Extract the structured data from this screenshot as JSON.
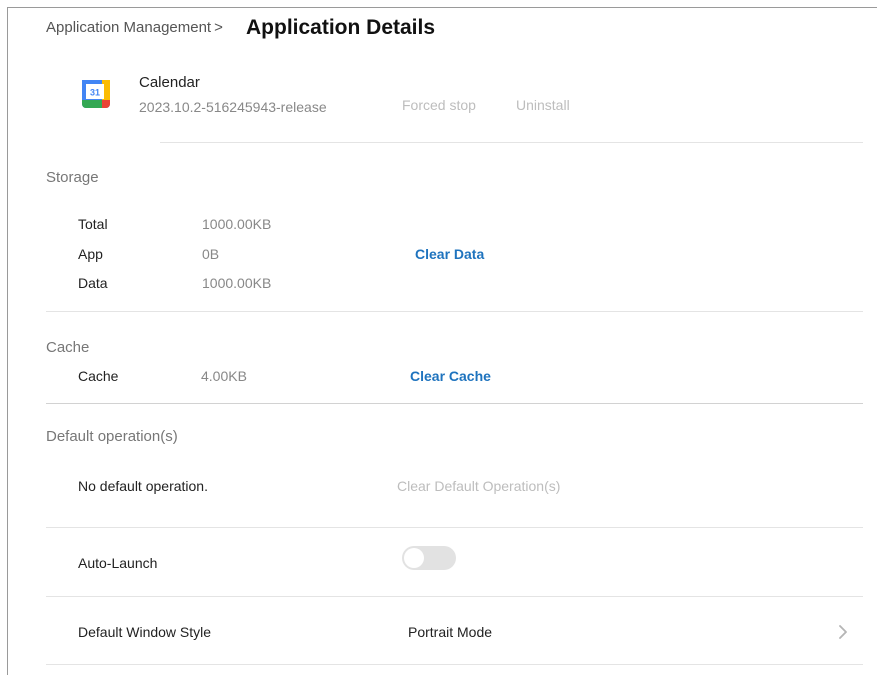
{
  "breadcrumb": {
    "parent": "Application Management",
    "separator": ">"
  },
  "page": {
    "title": "Application Details"
  },
  "app": {
    "name": "Calendar",
    "version": "2023.10.2-516245943-release",
    "icon": "google-calendar-icon",
    "icon_number": "31",
    "actions": {
      "forced_stop": "Forced stop",
      "uninstall": "Uninstall"
    }
  },
  "storage": {
    "title": "Storage",
    "rows": [
      {
        "label": "Total",
        "value": "1000.00KB"
      },
      {
        "label": "App",
        "value": "0B"
      },
      {
        "label": "Data",
        "value": "1000.00KB"
      }
    ],
    "clear_label": "Clear Data"
  },
  "cache": {
    "title": "Cache",
    "label": "Cache",
    "value": "4.00KB",
    "clear_label": "Clear Cache"
  },
  "default_ops": {
    "title": "Default operation(s)",
    "status": "No default operation.",
    "clear_label": "Clear Default Operation(s)"
  },
  "auto_launch": {
    "label": "Auto-Launch",
    "enabled": false
  },
  "window_style": {
    "label": "Default Window Style",
    "value": "Portrait Mode",
    "icon": "chevron-right-icon"
  },
  "colors": {
    "accent": "#1e73be",
    "disabled": "#bdbdbd",
    "divider": "#e4e4e4"
  }
}
